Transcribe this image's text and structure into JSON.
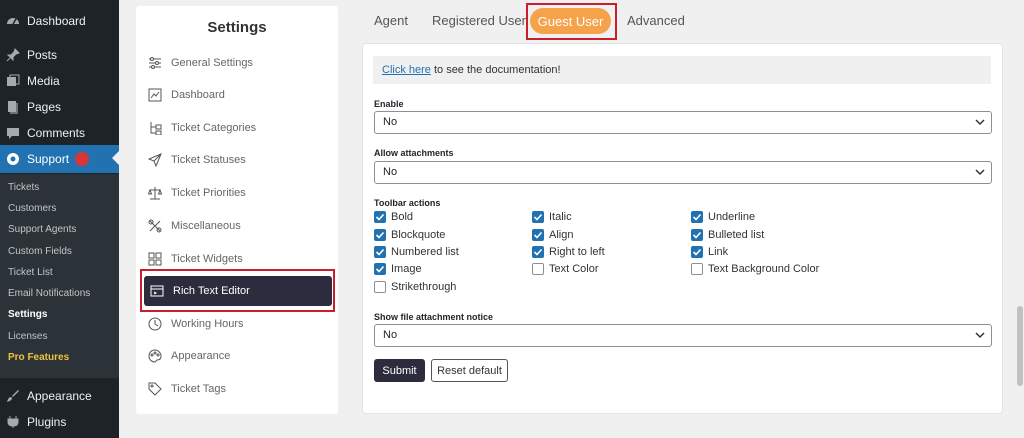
{
  "wp_menu": [
    {
      "label": "Dashboard",
      "icon": "dashboard-icon"
    },
    {
      "label": "Posts",
      "icon": "pin-icon"
    },
    {
      "label": "Media",
      "icon": "media-icon"
    },
    {
      "label": "Pages",
      "icon": "pages-icon"
    },
    {
      "label": "Comments",
      "icon": "comment-icon"
    },
    {
      "label": "Support",
      "icon": "support-icon"
    },
    {
      "label": "Appearance",
      "icon": "brush-icon"
    },
    {
      "label": "Plugins",
      "icon": "plug-icon"
    }
  ],
  "wp_submenu": [
    "Tickets",
    "Customers",
    "Support Agents",
    "Custom Fields",
    "Ticket List",
    "Email Notifications",
    "Settings",
    "Licenses",
    "Pro Features"
  ],
  "settings": {
    "title": "Settings",
    "items": [
      {
        "label": "General Settings",
        "icon": "sliders-icon"
      },
      {
        "label": "Dashboard",
        "icon": "chart-icon"
      },
      {
        "label": "Ticket Categories",
        "icon": "tree-icon"
      },
      {
        "label": "Ticket Statuses",
        "icon": "send-icon"
      },
      {
        "label": "Ticket Priorities",
        "icon": "balance-icon"
      },
      {
        "label": "Miscellaneous",
        "icon": "tools-icon"
      },
      {
        "label": "Ticket Widgets",
        "icon": "widgets-icon"
      },
      {
        "label": "Rich Text Editor",
        "icon": "editor-icon"
      },
      {
        "label": "Working Hours",
        "icon": "clock-icon"
      },
      {
        "label": "Appearance",
        "icon": "palette-icon"
      },
      {
        "label": "Ticket Tags",
        "icon": "tag-icon"
      }
    ]
  },
  "tabs": {
    "agent": "Agent",
    "registered": "Registered User",
    "guest": "Guest User",
    "advanced": "Advanced"
  },
  "doc": {
    "link": "Click here",
    "text": " to see the documentation!"
  },
  "form": {
    "enable_label": "Enable",
    "enable_value": "No",
    "attach_label": "Allow attachments",
    "attach_value": "No",
    "toolbar_label": "Toolbar actions",
    "toolbar": [
      {
        "label": "Bold",
        "checked": true
      },
      {
        "label": "Italic",
        "checked": true
      },
      {
        "label": "Underline",
        "checked": true
      },
      {
        "label": "Blockquote",
        "checked": true
      },
      {
        "label": "Align",
        "checked": true
      },
      {
        "label": "Bulleted list",
        "checked": true
      },
      {
        "label": "Numbered list",
        "checked": true
      },
      {
        "label": "Right to left",
        "checked": true
      },
      {
        "label": "Link",
        "checked": true
      },
      {
        "label": "Image",
        "checked": true
      },
      {
        "label": "Text Color",
        "checked": false
      },
      {
        "label": "Text Background Color",
        "checked": false
      },
      {
        "label": "Strikethrough",
        "checked": false
      }
    ],
    "notice_label": "Show file attachment notice",
    "notice_value": "No",
    "submit": "Submit",
    "reset": "Reset default"
  },
  "colors": {
    "accent": "#f6a24b",
    "wp_blue": "#2271b1",
    "dark": "#2c2c3e",
    "highlight": "#c7202c"
  }
}
